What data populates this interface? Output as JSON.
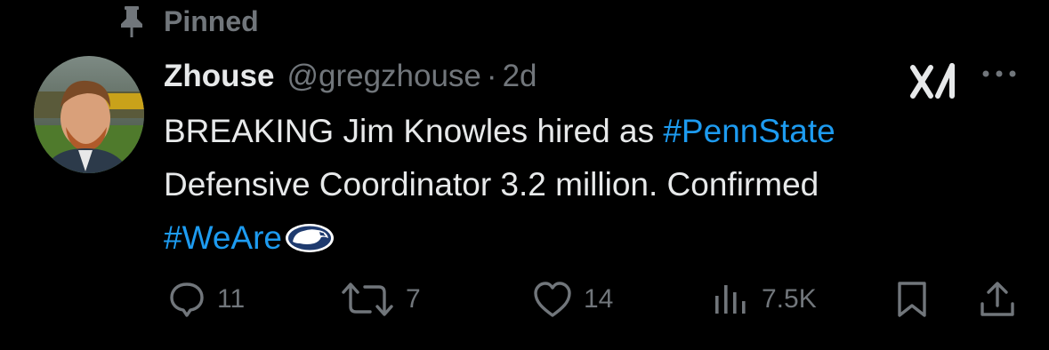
{
  "pinned": {
    "label": "Pinned",
    "icon": "pin-icon"
  },
  "tweet": {
    "author": {
      "display_name": "Zhouse",
      "handle": "@gregzhouse",
      "separator": "·",
      "age": "2d"
    },
    "text": {
      "line1_prefix": "BREAKING Jim Knowles hired as ",
      "line1_hashtag": "#PennState",
      "line2": "Defensive Coordinator 3.2 million. Confirmed",
      "line3_hashtag": "#WeAre"
    }
  },
  "actions": {
    "reply_count": "11",
    "retweet_count": "7",
    "like_count": "14",
    "views_count": "7.5K"
  },
  "colors": {
    "background": "#000000",
    "text": "#e7e9ea",
    "muted": "#71767b",
    "hashtag": "#1d9bf0",
    "psu_navy": "#1e3a6e"
  },
  "icons": [
    "pin-icon",
    "avatar",
    "grok-icon",
    "more-icon",
    "penn-state-logo-icon",
    "reply-icon",
    "retweet-icon",
    "like-icon",
    "views-icon",
    "bookmark-icon",
    "share-icon"
  ]
}
